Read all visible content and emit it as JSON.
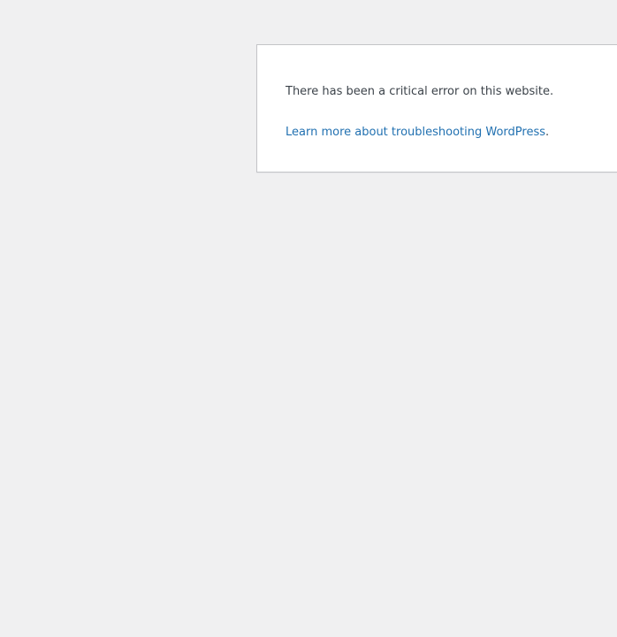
{
  "error": {
    "message": "There has been a critical error on this website.",
    "link_text": "Learn more about troubleshooting WordPress",
    "link_suffix": "."
  },
  "colors": {
    "background": "#f0f0f1",
    "panel": "#ffffff",
    "border": "#c3c4c7",
    "text": "#3c434a",
    "link": "#2271b1"
  }
}
